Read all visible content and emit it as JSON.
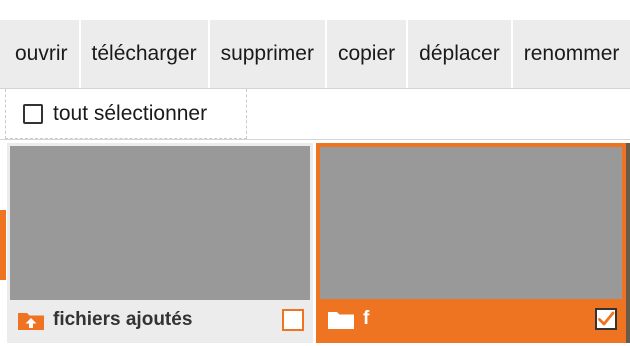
{
  "toolbar": {
    "actions": [
      {
        "label": "ouvrir"
      },
      {
        "label": "télécharger"
      },
      {
        "label": "supprimer"
      },
      {
        "label": "copier"
      },
      {
        "label": "déplacer"
      },
      {
        "label": "renommer"
      }
    ]
  },
  "selection": {
    "select_all_label": "tout sélectionner",
    "select_all_checked": false
  },
  "items": [
    {
      "name": "fichiers ajoutés",
      "icon": "folder-upload-icon",
      "checked": false,
      "selected": false
    },
    {
      "name": "f",
      "icon": "folder-icon",
      "checked": true,
      "selected": true
    }
  ],
  "colors": {
    "accent": "#ee7422",
    "toolbar_bg": "#ececec",
    "thumbnail": "#999999"
  }
}
